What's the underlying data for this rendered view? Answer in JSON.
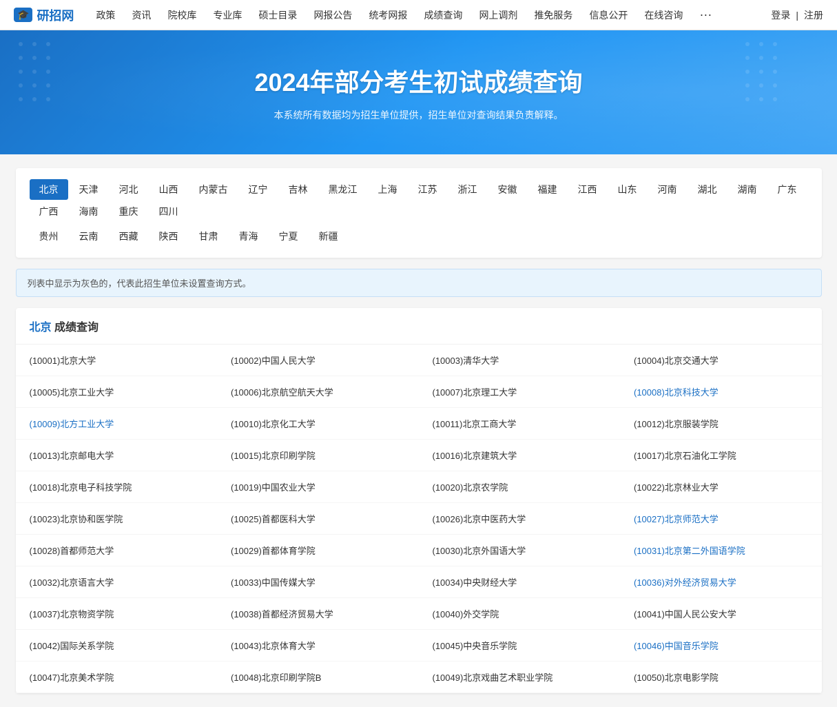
{
  "nav": {
    "logo": "研招网",
    "logo_icon": "🎓",
    "links": [
      "政策",
      "资讯",
      "院校库",
      "专业库",
      "硕士目录",
      "网报公告",
      "统考网报",
      "成绩查询",
      "网上调剂",
      "推免服务",
      "信息公开",
      "在线咨询"
    ],
    "more": "···",
    "login": "登录",
    "register": "注册",
    "divider": "|"
  },
  "banner": {
    "title": "2024年部分考生初试成绩查询",
    "subtitle": "本系统所有数据均为招生单位提供，招生单位对查询结果负责解释。"
  },
  "regions": {
    "row1": [
      "北京",
      "天津",
      "河北",
      "山西",
      "内蒙古",
      "辽宁",
      "吉林",
      "黑龙江",
      "上海",
      "江苏",
      "浙江",
      "安徽",
      "福建",
      "江西",
      "山东",
      "河南",
      "湖北",
      "湖南",
      "广东",
      "广西",
      "海南",
      "重庆",
      "四川"
    ],
    "row2": [
      "贵州",
      "云南",
      "西藏",
      "陕西",
      "甘肃",
      "青海",
      "宁夏",
      "新疆"
    ]
  },
  "active_region": "北京",
  "info_text": "列表中显示为灰色的，代表此招生单位未设置查询方式。",
  "results": {
    "title": "成绩查询",
    "region": "北京",
    "schools": [
      {
        "id": "10001",
        "name": "北京大学",
        "link": false
      },
      {
        "id": "10002",
        "name": "中国人民大学",
        "link": false
      },
      {
        "id": "10003",
        "name": "清华大学",
        "link": false
      },
      {
        "id": "10004",
        "name": "北京交通大学",
        "link": false
      },
      {
        "id": "10005",
        "name": "北京工业大学",
        "link": false
      },
      {
        "id": "10006",
        "name": "北京航空航天大学",
        "link": false
      },
      {
        "id": "10007",
        "name": "北京理工大学",
        "link": false
      },
      {
        "id": "10008",
        "name": "北京科技大学",
        "link": true
      },
      {
        "id": "10009",
        "name": "北方工业大学",
        "link": true
      },
      {
        "id": "10010",
        "name": "北京化工大学",
        "link": false
      },
      {
        "id": "10011",
        "name": "北京工商大学",
        "link": false
      },
      {
        "id": "10012",
        "name": "北京服装学院",
        "link": false
      },
      {
        "id": "10013",
        "name": "北京邮电大学",
        "link": false
      },
      {
        "id": "10015",
        "name": "北京印刷学院",
        "link": false
      },
      {
        "id": "10016",
        "name": "北京建筑大学",
        "link": false
      },
      {
        "id": "10017",
        "name": "北京石油化工学院",
        "link": false
      },
      {
        "id": "10018",
        "name": "北京电子科技学院",
        "link": false
      },
      {
        "id": "10019",
        "name": "中国农业大学",
        "link": false
      },
      {
        "id": "10020",
        "name": "北京农学院",
        "link": false
      },
      {
        "id": "10022",
        "name": "北京林业大学",
        "link": false
      },
      {
        "id": "10023",
        "name": "北京协和医学院",
        "link": false
      },
      {
        "id": "10025",
        "name": "首都医科大学",
        "link": false
      },
      {
        "id": "10026",
        "name": "北京中医药大学",
        "link": false
      },
      {
        "id": "10027",
        "name": "北京师范大学",
        "link": true
      },
      {
        "id": "10028",
        "name": "首都师范大学",
        "link": false
      },
      {
        "id": "10029",
        "name": "首都体育学院",
        "link": false
      },
      {
        "id": "10030",
        "name": "北京外国语大学",
        "link": false
      },
      {
        "id": "10031",
        "name": "北京第二外国语学院",
        "link": true
      },
      {
        "id": "10032",
        "name": "北京语言大学",
        "link": false
      },
      {
        "id": "10033",
        "name": "中国传媒大学",
        "link": false
      },
      {
        "id": "10034",
        "name": "中央财经大学",
        "link": false
      },
      {
        "id": "10036",
        "name": "对外经济贸易大学",
        "link": true
      },
      {
        "id": "10037",
        "name": "北京物资学院",
        "link": false
      },
      {
        "id": "10038",
        "name": "首都经济贸易大学",
        "link": false
      },
      {
        "id": "10040",
        "name": "外交学院",
        "link": false
      },
      {
        "id": "10041",
        "name": "中国人民公安大学",
        "link": false
      },
      {
        "id": "10042",
        "name": "国际关系学院",
        "link": false
      },
      {
        "id": "10043",
        "name": "北京体育大学",
        "link": false
      },
      {
        "id": "10045",
        "name": "中央音乐学院",
        "link": false
      },
      {
        "id": "10046",
        "name": "中国音乐学院",
        "link": true
      },
      {
        "id": "10047",
        "name": "北京美术学院",
        "link": false
      },
      {
        "id": "10048",
        "name": "北京印刷学院B",
        "link": false
      },
      {
        "id": "10049",
        "name": "北京戏曲艺术职业学院",
        "link": false
      },
      {
        "id": "10050",
        "name": "北京电影学院",
        "link": false
      }
    ]
  }
}
